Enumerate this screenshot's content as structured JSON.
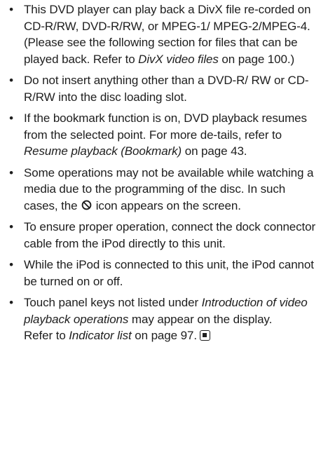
{
  "bullets": [
    {
      "parts": [
        {
          "t": "This DVD player can play back a DivX file re-corded on CD-R/RW, DVD-R/RW, or MPEG-1/ MPEG-2/MPEG-4. (Please see the following section for files that can be played back. Refer to "
        },
        {
          "t": "DivX video files",
          "i": true
        },
        {
          "t": " on page 100.)"
        }
      ]
    },
    {
      "parts": [
        {
          "t": "Do not insert anything other than a DVD-R/ RW or CD-R/RW into the disc loading slot."
        }
      ]
    },
    {
      "parts": [
        {
          "t": "If the bookmark function is on, DVD playback resumes from the selected point. For more de-tails, refer to "
        },
        {
          "t": "Resume playback (Bookmark)",
          "i": true
        },
        {
          "t": " on page 43."
        }
      ]
    },
    {
      "parts": [
        {
          "t": "Some operations may not be available while watching a media due to the programming of the disc. In such cases, the "
        },
        {
          "icon": "prohibited-icon"
        },
        {
          "t": " icon appears on the screen."
        }
      ]
    },
    {
      "parts": [
        {
          "t": "To ensure proper operation, connect the dock connector cable from the iPod directly to this unit."
        }
      ]
    },
    {
      "parts": [
        {
          "t": "While the iPod is connected to this unit, the iPod cannot be turned on or off."
        }
      ]
    },
    {
      "parts": [
        {
          "t": "Touch panel keys not listed under "
        },
        {
          "t": "Introduction of video playback operations",
          "i": true
        },
        {
          "t": " may appear on the display."
        }
      ],
      "subline": [
        {
          "t": "Refer to "
        },
        {
          "t": "Indicator list",
          "i": true
        },
        {
          "t": " on page 97."
        },
        {
          "icon": "end-of-section-icon"
        }
      ]
    }
  ],
  "bullet_char": "•"
}
